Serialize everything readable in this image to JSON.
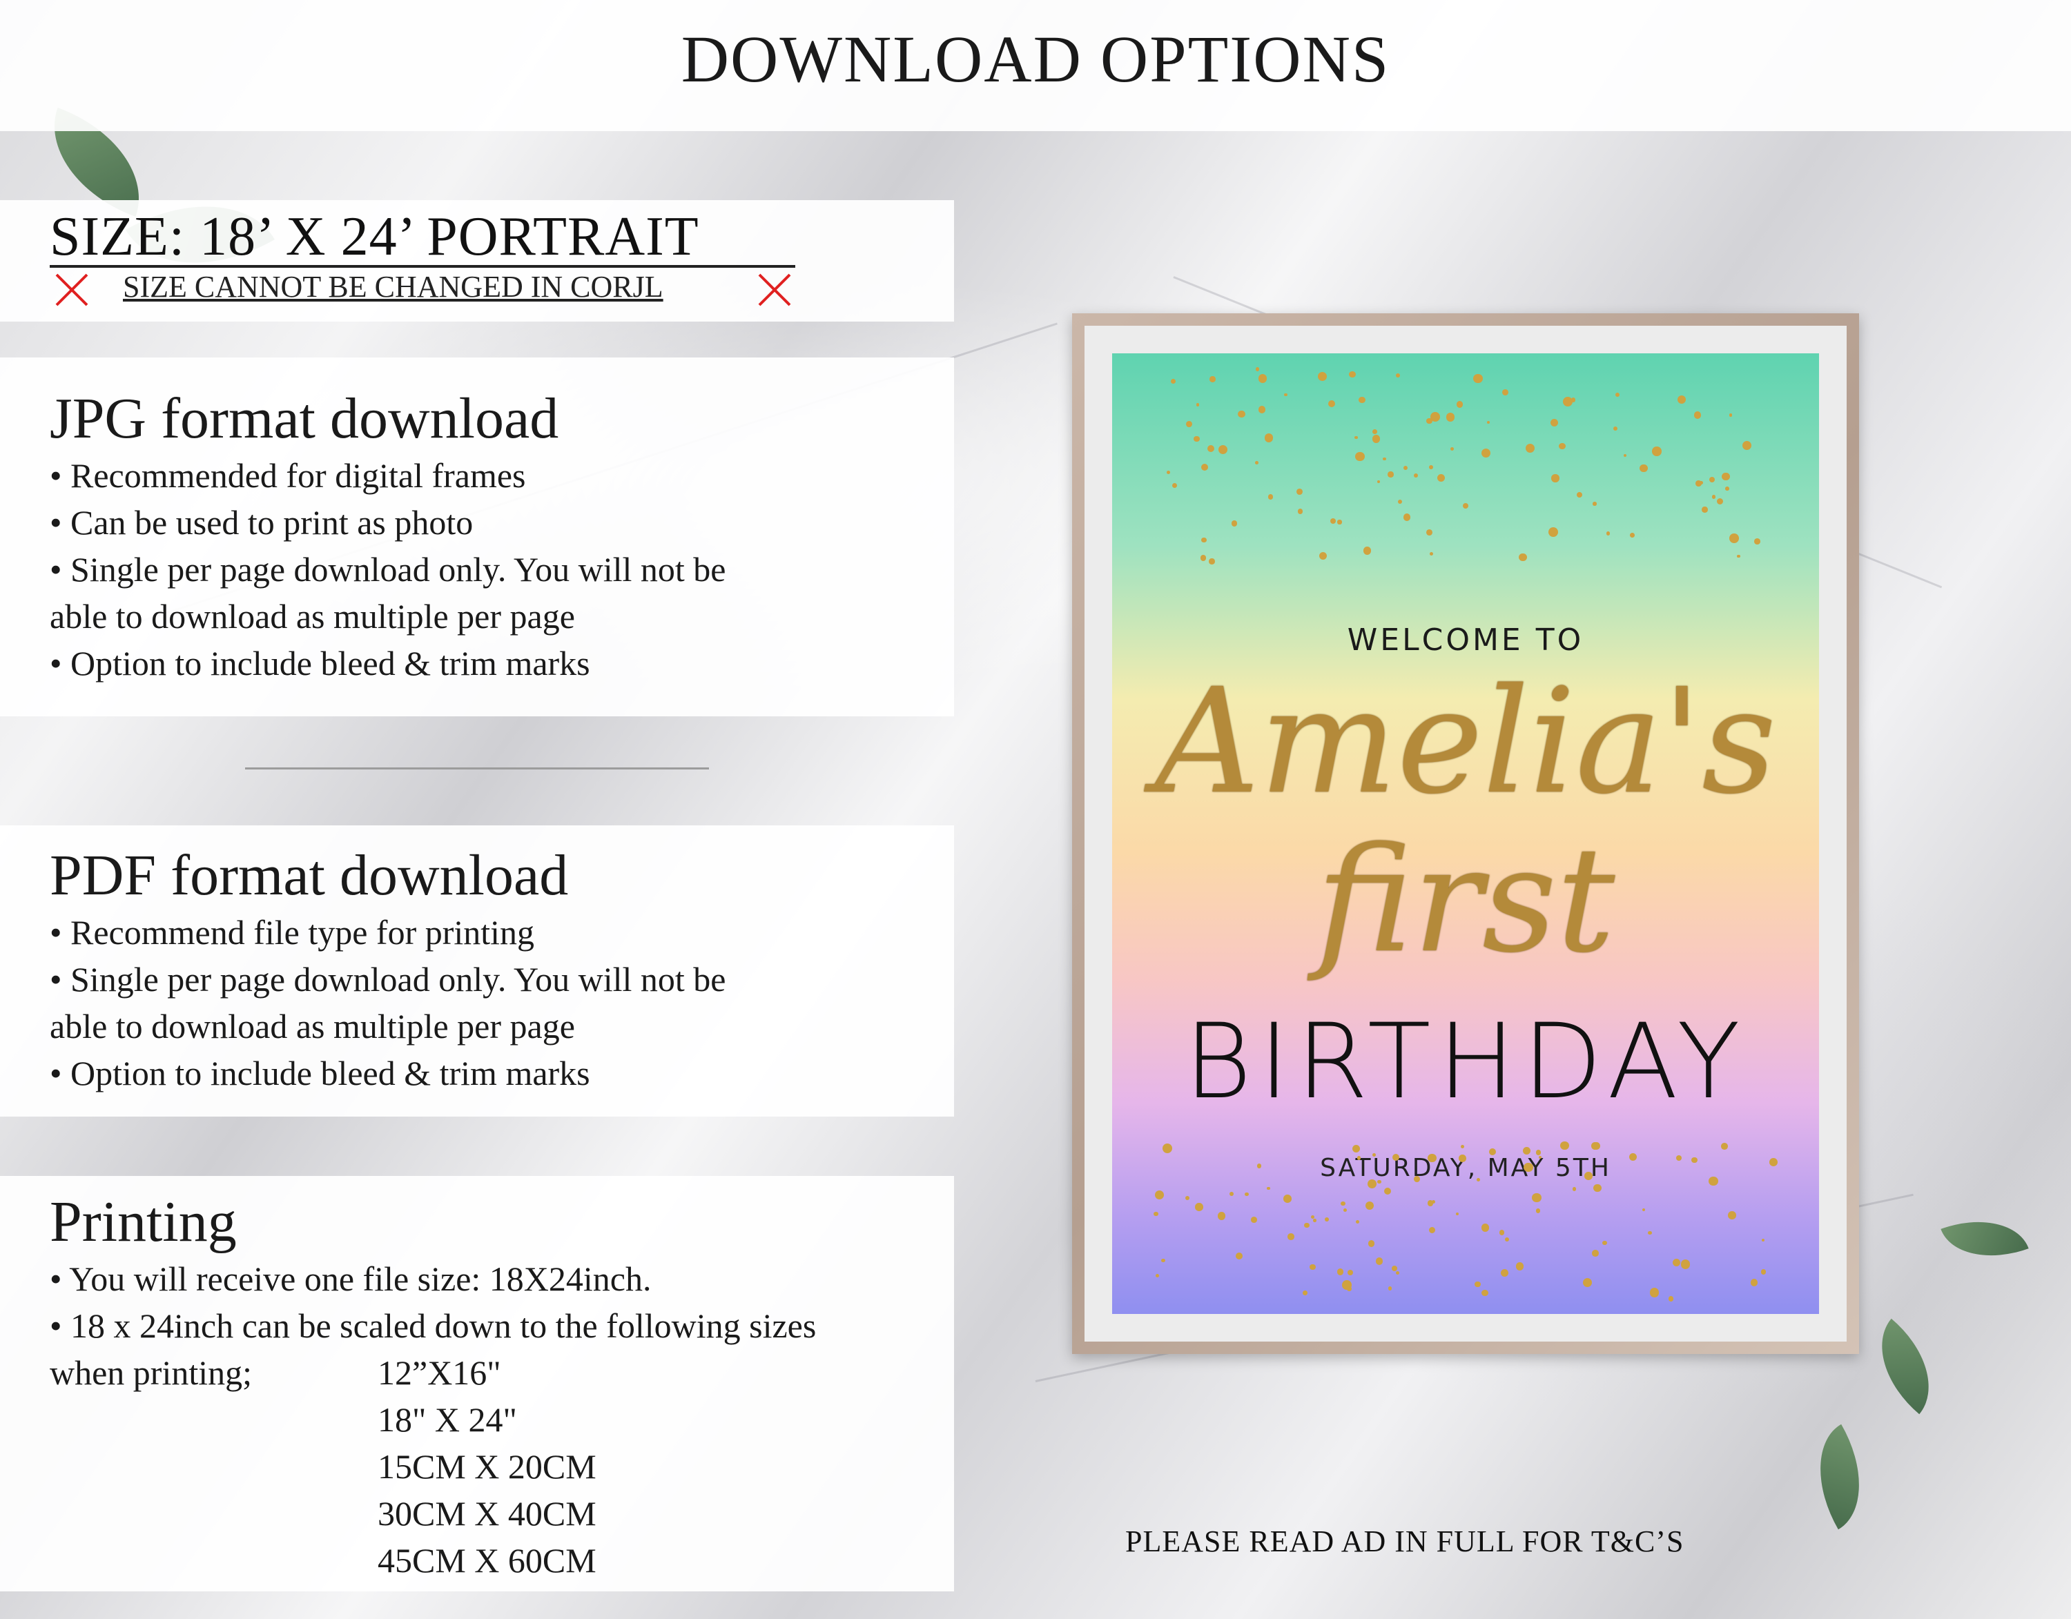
{
  "header": {
    "title": "DOWNLOAD OPTIONS"
  },
  "size": {
    "title": "SIZE: 18’ X 24’ PORTRAIT",
    "note": "SIZE CANNOT BE CHANGED IN CORJL",
    "x_color": "#e02020"
  },
  "jpg": {
    "heading": "JPG format download",
    "lines": [
      "• Recommended for digital frames",
      "• Can be used to print as photo",
      "• Single per page download only. You will not be",
      "able to download as multiple per page",
      "• Option to include bleed & trim marks"
    ]
  },
  "pdf": {
    "heading": "PDF format download",
    "lines": [
      "• Recommend file type for printing",
      "• Single per page download only. You will not be",
      "able to download as multiple per page",
      "• Option to include bleed & trim marks"
    ]
  },
  "printing": {
    "heading": "Printing",
    "lines": [
      "• You will receive one file size: 18X24inch.",
      "• 18 x 24inch can be scaled down to the following sizes"
    ],
    "when_label": "when printing;",
    "sizes": [
      "12”X16\"",
      "18\" X 24\"",
      "15CM X 20CM",
      "30CM X 40CM",
      "45CM X 60CM"
    ]
  },
  "poster": {
    "welcome": "WELCOME TO",
    "name": "Amelia's",
    "first": "first",
    "birthday": "BIRTHDAY",
    "date": "SATURDAY, MAY 5TH",
    "glitter_color": "#d0a23f"
  },
  "footer": {
    "note": "PLEASE READ AD IN FULL FOR T&C’S"
  }
}
